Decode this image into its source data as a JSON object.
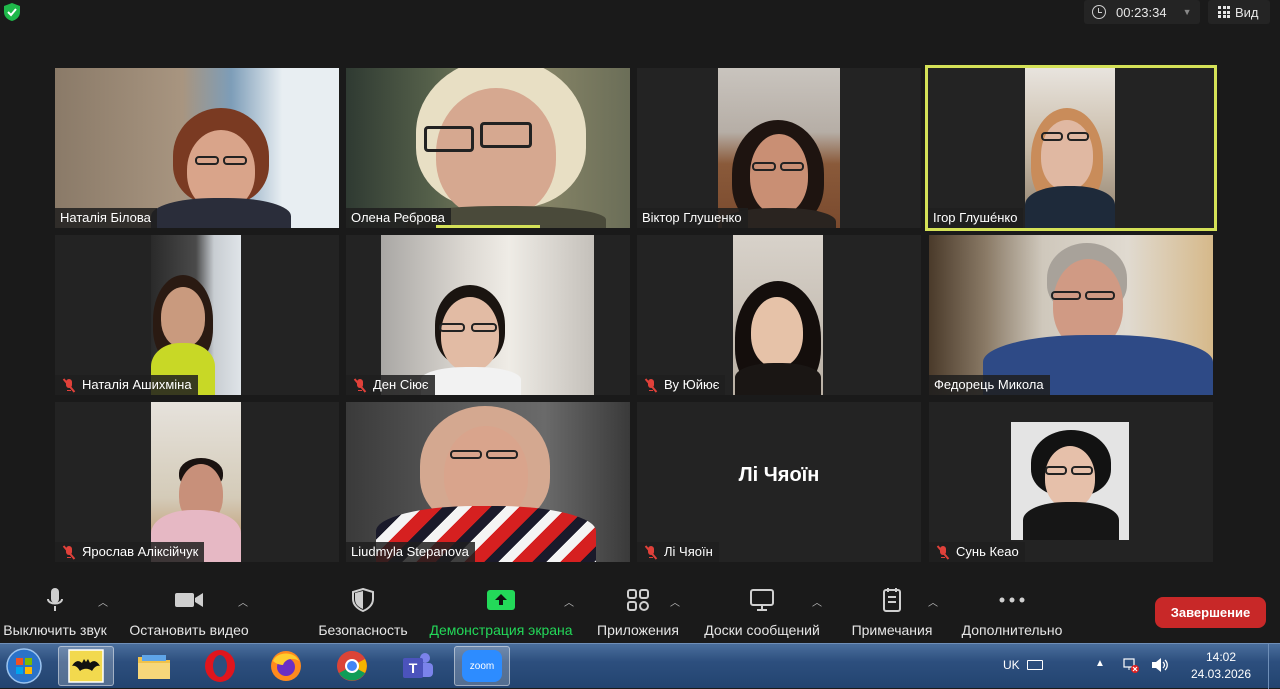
{
  "timer": "00:23:34",
  "view_label": "Вид",
  "participants": [
    {
      "name": "Наталія Білова",
      "muted": false
    },
    {
      "name": "Олена Реброва",
      "muted": false
    },
    {
      "name": "Віктор Глушенко",
      "muted": false
    },
    {
      "name": "Ігор Глушéнко",
      "muted": false
    },
    {
      "name": "Наталія Ашихміна",
      "muted": true
    },
    {
      "name": "Ден Сіює",
      "muted": true
    },
    {
      "name": "Ву Юйює",
      "muted": true
    },
    {
      "name": "Федорець Микола",
      "muted": false
    },
    {
      "name": "Ярослав Аліксійчук",
      "muted": true
    },
    {
      "name": "Liudmyla Stepanova",
      "muted": false
    },
    {
      "name": "Лі Чяоїн",
      "muted": true
    },
    {
      "name": "Сунь Кеао",
      "muted": true
    }
  ],
  "no_video_name": "Лі Чяоїн",
  "toolbar": {
    "mute": "Выключить звук",
    "video": "Остановить видео",
    "security": "Безопасность",
    "share": "Демонстрация экрана",
    "apps": "Приложения",
    "whiteboards": "Доски сообщений",
    "notes": "Примечания",
    "more": "Дополнительно",
    "end": "Завершение"
  },
  "colors": {
    "share_green": "#23d959",
    "end_red": "#c82828",
    "active_speaker": "#d4e157",
    "mute_red": "#e0413a"
  },
  "taskbar": {
    "apps": [
      "windows-start",
      "bat-app",
      "file-explorer",
      "opera",
      "firefox",
      "chrome",
      "teams",
      "zoom"
    ],
    "zoom_label": "zoom",
    "language": "UK",
    "time": "14:02",
    "date": "24.03.2026"
  }
}
